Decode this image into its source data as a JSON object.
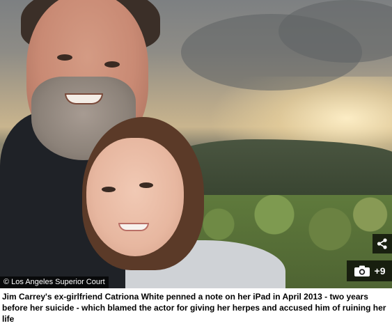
{
  "photo": {
    "copyright_text": "© Los Angeles Superior Court",
    "share_icon": "share-icon",
    "gallery_icon": "camera-icon",
    "gallery_count": "+9"
  },
  "caption": {
    "text": "Jim Carrey's ex-girlfriend Catriona White penned a note on her iPad in April 2013 - two years before her suicide - which blamed the actor for giving her herpes and accused him of ruining her life"
  }
}
